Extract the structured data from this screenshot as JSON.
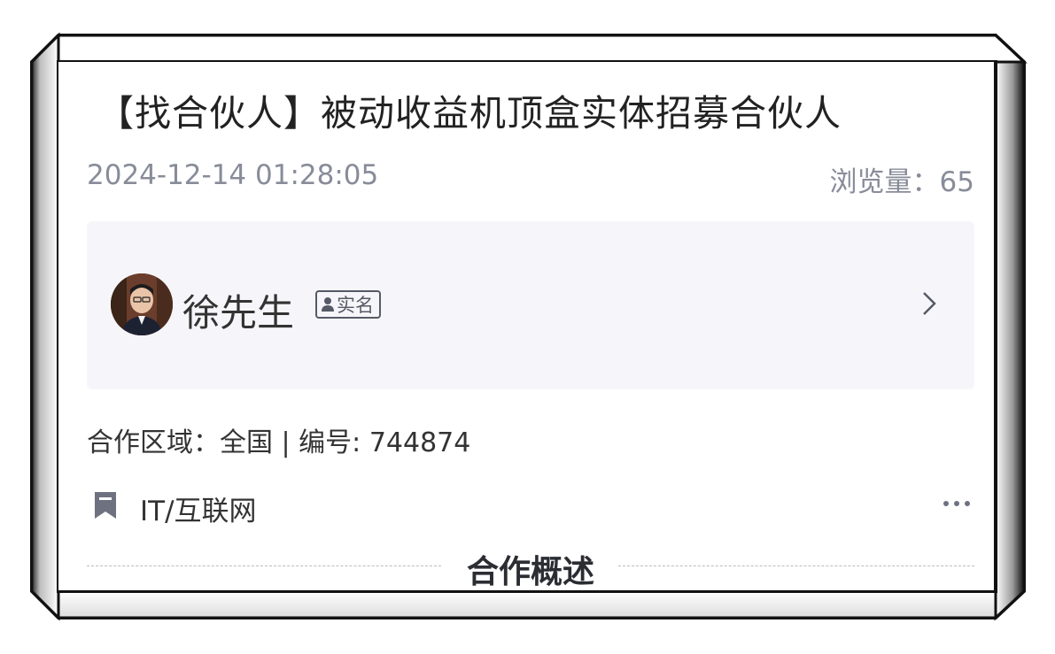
{
  "post": {
    "title": "【找合伙人】被动收益机顶盒实体招募合伙人",
    "date": "2024-12-14 01:28:05",
    "views": "浏览量：65"
  },
  "author": {
    "name": "徐先生",
    "badge": "实名"
  },
  "details": {
    "info": "合作区域：全国 | 编号: 744874",
    "category": "IT/互联网"
  },
  "section": {
    "title": "合作概述"
  },
  "icons": {
    "avatar": "person-photo",
    "badge_icon": "person-icon",
    "chevron": "chevron-right-icon",
    "category": "bookmark-icon",
    "more": "more-dots-icon"
  },
  "colors": {
    "card_bg": "#f6f6fa",
    "muted_text": "#888c99",
    "icon_gray": "#6e7180"
  }
}
